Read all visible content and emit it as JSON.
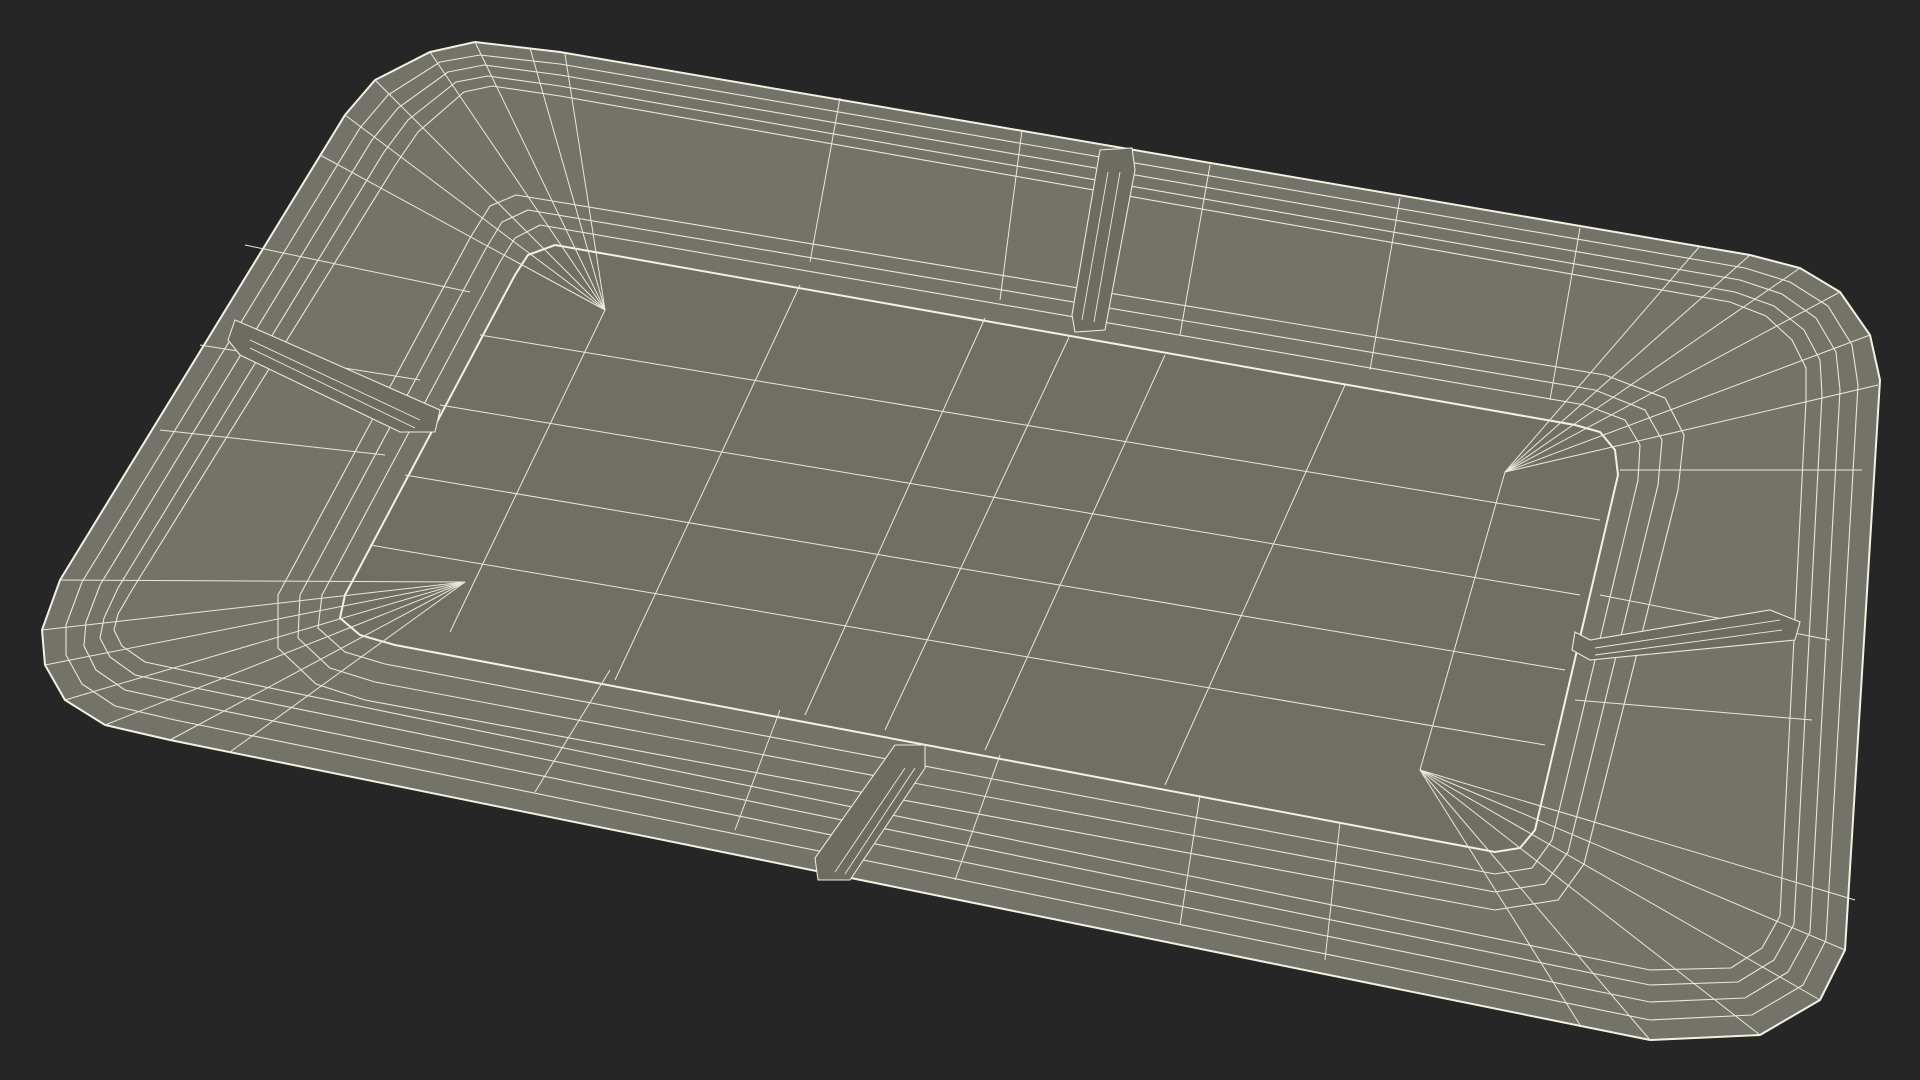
{
  "scene": {
    "subject": "wireframe-tray",
    "colors": {
      "background": "#262626",
      "surface": "#73736a",
      "surface_dark": "#6b6b62",
      "wire": "#e9e8d8",
      "edge": "#f2f1e2"
    }
  }
}
